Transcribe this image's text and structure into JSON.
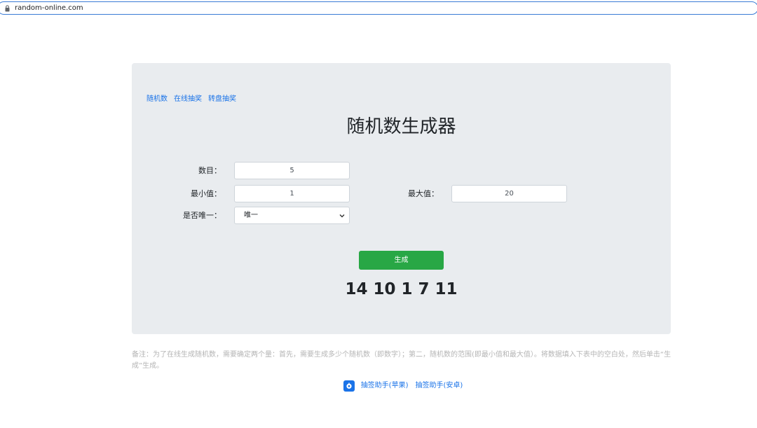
{
  "browser": {
    "url": "random-online.com"
  },
  "nav": {
    "items": [
      {
        "label": "随机数"
      },
      {
        "label": "在线抽奖"
      },
      {
        "label": "转盘抽奖"
      }
    ]
  },
  "page": {
    "title": "随机数生成器"
  },
  "form": {
    "count_label": "数目：",
    "count_value": "5",
    "min_label": "最小值：",
    "min_value": "1",
    "max_label": "最大值：",
    "max_value": "20",
    "unique_label": "是否唯一：",
    "unique_selected": "唯一"
  },
  "action": {
    "generate_label": "生成"
  },
  "result": {
    "numbers": "14 10 1 7 11"
  },
  "note": {
    "text": "备注：为了在线生成随机数，需要确定两个量：首先，需要生成多少个随机数（即数字）；第二，随机数的范围(即最小值和最大值）。将数据填入下表中的空白处，然后单击“生成”生成。"
  },
  "footer": {
    "link_apple": "抽签助手(苹果)",
    "link_android": "抽签助手(安卓)"
  },
  "colors": {
    "accent": "#1a73e8",
    "button": "#28a745",
    "panel": "#e9ecef"
  }
}
